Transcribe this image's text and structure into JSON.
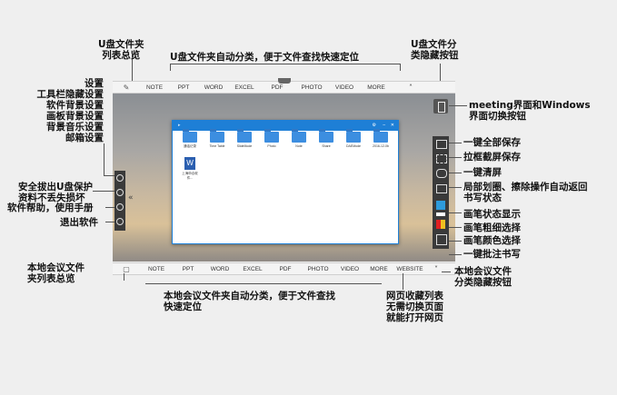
{
  "annotations": {
    "u_overview": "U盘文件夹\n列表总览",
    "u_auto_classify": "U盘文件夹自动分类，便于文件查找快速定位",
    "u_hide_btn": "U盘文件分\n类隐藏按钮",
    "settings": "设置\n工具栏隐藏设置\n软件背景设置\n画板背景设置\n背景音乐设置\n邮箱设置",
    "meeting_switch": "meeting界面和Windows\n界面切换按钮",
    "save_all": "一键全部保存",
    "capture_save": "拉框截屏保存",
    "clear": "一键清屏",
    "auto_return": "局部划圈、擦除操作自动返回\n书写状态",
    "pen_state": "画笔状态显示",
    "pen_width": "画笔粗细选择",
    "pen_color": "画笔颜色选择",
    "batch_write": "一键批注书写",
    "eject_u": "安全拔出U盘保护\n资料不丢失损坏",
    "help": "软件帮助，使用手册",
    "exit": "退出软件",
    "local_overview": "本地会议文件\n夹列表总览",
    "local_auto_classify": "本地会议文件夹自动分类，便于文件查找\n快速定位",
    "web_favorites": "网页收藏列表\n无需切换页面\n就能打开网页",
    "local_hide_btn": "本地会议文件\n分类隐藏按钮"
  },
  "top_bar": [
    "NOTE",
    "PPT",
    "WORD",
    "EXCEL",
    "PDF",
    "PHOTO",
    "VIDEO",
    "MORE"
  ],
  "bottom_bar": [
    "NOTE",
    "PPT",
    "WORD",
    "EXCEL",
    "PDF",
    "PHOTO",
    "VIDEO",
    "MORE",
    "WEBSITE"
  ],
  "window": {
    "folders": [
      "通话记录",
      "Time Table",
      "SlideMode",
      "Photo",
      "Note",
      "Share",
      "DAEMode",
      "2016-12-0b"
    ],
    "file": "上海申合软件..."
  },
  "colors": {
    "accent": "#1e7fd6",
    "toolbar": "#3a3a3a"
  }
}
